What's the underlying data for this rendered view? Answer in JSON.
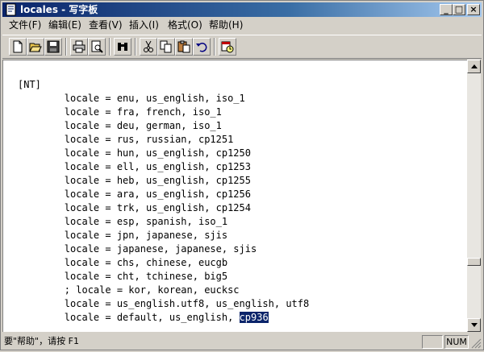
{
  "window": {
    "title": "locales - 写字板",
    "minimize_glyph": "_",
    "maximize_glyph": "□",
    "close_glyph": "×"
  },
  "menu": [
    {
      "label": "文件(F)"
    },
    {
      "label": "编辑(E)"
    },
    {
      "label": "查看(V)"
    },
    {
      "label": "插入(I)"
    },
    {
      "label": "格式(O)"
    },
    {
      "label": "帮助(H)"
    }
  ],
  "toolbar": [
    {
      "icon": "new-document-icon"
    },
    {
      "icon": "open-folder-icon"
    },
    {
      "icon": "save-disk-icon"
    },
    {
      "icon": "print-icon"
    },
    {
      "icon": "print-preview-icon"
    },
    {
      "icon": "find-binoculars-icon"
    },
    {
      "icon": "cut-scissors-icon"
    },
    {
      "icon": "copy-icon"
    },
    {
      "icon": "paste-icon"
    },
    {
      "icon": "undo-icon"
    },
    {
      "icon": "insert-date-time-icon"
    }
  ],
  "document": {
    "lines": [
      "[NT]",
      "        locale = enu, us_english, iso_1",
      "        locale = fra, french, iso_1",
      "        locale = deu, german, iso_1",
      "        locale = rus, russian, cp1251",
      "        locale = hun, us_english, cp1250",
      "        locale = ell, us_english, cp1253",
      "        locale = heb, us_english, cp1255",
      "        locale = ara, us_english, cp1256",
      "        locale = trk, us_english, cp1254",
      "        locale = esp, spanish, iso_1",
      "        locale = jpn, japanese, sjis",
      "        locale = japanese, japanese, sjis",
      "        locale = chs, chinese, eucgb",
      "        locale = cht, tchinese, big5",
      "        ; locale = kor, korean, eucksc",
      "        locale = us_english.utf8, us_english, utf8"
    ],
    "last_line_prefix": "        locale = default, us_english, ",
    "selected_text": "cp936"
  },
  "scrollbar": {
    "position_fraction": 0.78
  },
  "status": {
    "help_text": "要\"帮助\"，请按 F1",
    "num_indicator": "NUM"
  },
  "colors": {
    "title_start": "#0a246a",
    "selection": "#0a246a",
    "chrome": "#d4d0c8"
  }
}
